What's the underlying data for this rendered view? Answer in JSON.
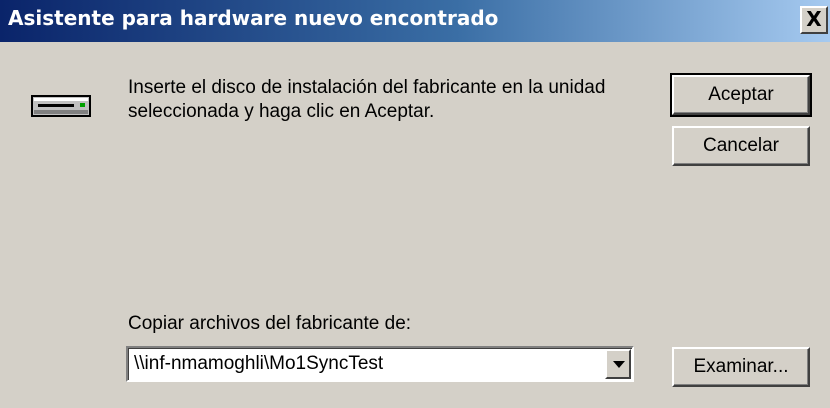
{
  "window": {
    "title": "Asistente para hardware nuevo encontrado",
    "close_label": "X"
  },
  "message": "Inserte el disco de instalación del fabricante en la unidad seleccionada y haga clic en Aceptar.",
  "buttons": {
    "ok_label": "Aceptar",
    "cancel_label": "Cancelar",
    "browse_label": "Examinar..."
  },
  "copy_from": {
    "label": "Copiar archivos del fabricante de:",
    "value": "\\\\inf-nmamoghli\\Mo1SyncTest"
  },
  "icons": {
    "drive": "disk-drive-icon",
    "dropdown": "chevron-down-icon"
  },
  "colors": {
    "title_bar_start": "#0a246a",
    "title_bar_end": "#a6caf0",
    "dialog_background": "#d4d0c8"
  }
}
